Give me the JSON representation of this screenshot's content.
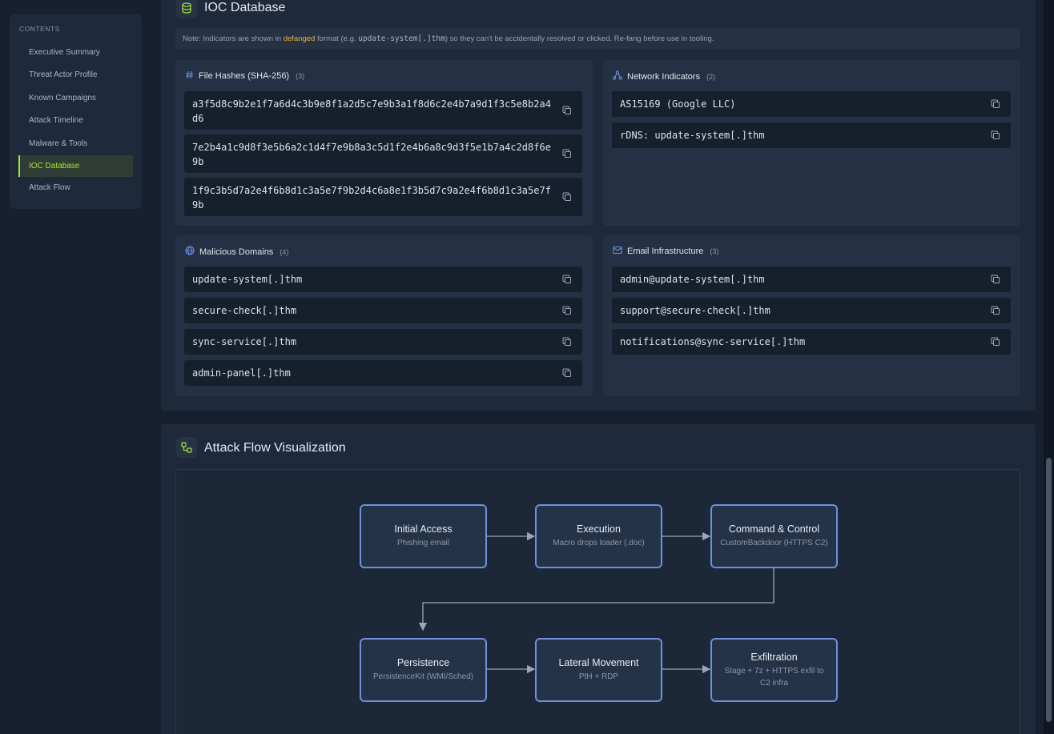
{
  "toc": {
    "heading": "CONTENTS",
    "items": [
      {
        "label": "Executive Summary",
        "active": false
      },
      {
        "label": "Threat Actor Profile",
        "active": false
      },
      {
        "label": "Known Campaigns",
        "active": false
      },
      {
        "label": "Attack Timeline",
        "active": false
      },
      {
        "label": "Malware & Tools",
        "active": false
      },
      {
        "label": "IOC Database",
        "active": true
      },
      {
        "label": "Attack Flow",
        "active": false
      }
    ]
  },
  "ioc": {
    "title": "IOC Database",
    "note": {
      "prefix": "Note: Indicators are shown in",
      "highlight": "defanged",
      "middle": "format (e.g.",
      "example": "update-system[.]thm",
      "suffix": ") so they can't be accidentally resolved or clicked. Re-fang before use in tooling."
    },
    "file_hashes": {
      "title": "File Hashes (SHA-256)",
      "count": "(3)",
      "items": [
        "a3f5d8c9b2e1f7a6d4c3b9e8f1a2d5c7e9b3a1f8d6c2e4b7a9d1f3c5e8b2a4d6",
        "7e2b4a1c9d8f3e5b6a2c1d4f7e9b8a3c5d1f2e4b6a8c9d3f5e1b7a4c2d8f6e9b",
        "1f9c3b5d7a2e4f6b8d1c3a5e7f9b2d4c6a8e1f3b5d7c9a2e4f6b8d1c3a5e7f9b"
      ]
    },
    "network": {
      "title": "Network Indicators",
      "count": "(2)",
      "items": [
        "AS15169 (Google LLC)",
        "rDNS: update-system[.]thm"
      ]
    },
    "domains": {
      "title": "Malicious Domains",
      "count": "(4)",
      "items": [
        "update-system[.]thm",
        "secure-check[.]thm",
        "sync-service[.]thm",
        "admin-panel[.]thm"
      ]
    },
    "email": {
      "title": "Email Infrastructure",
      "count": "(3)",
      "items": [
        "admin@update-system[.]thm",
        "support@secure-check[.]thm",
        "notifications@sync-service[.]thm"
      ]
    }
  },
  "flow": {
    "title": "Attack Flow Visualization",
    "nodes": [
      {
        "title": "Initial Access",
        "sub": "Phishing email"
      },
      {
        "title": "Execution",
        "sub": "Macro drops loader (.doc)"
      },
      {
        "title": "Command & Control",
        "sub": "CustomBackdoor (HTTPS C2)"
      },
      {
        "title": "Persistence",
        "sub": "PersistenceKit (WMI/Sched)"
      },
      {
        "title": "Lateral Movement",
        "sub": "PtH + RDP"
      },
      {
        "title": "Exfiltration",
        "sub": "Stage + 7z + HTTPS exfil to C2 infra"
      }
    ]
  },
  "colors": {
    "accent": "#a3e635",
    "node_border": "#6f8fe0",
    "highlight": "#f0b341"
  }
}
